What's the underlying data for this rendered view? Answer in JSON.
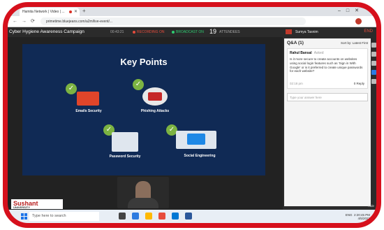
{
  "browser": {
    "tab_title": "Hamita Network | Video | ...",
    "url": "primetime.bluejeans.com/a2m/live-event/..."
  },
  "app": {
    "title": "Cyber Hygiene Awareness Campaign",
    "timer": "00:43:21",
    "recording_label": "RECORDING ON",
    "broadcast_label": "BROADCAST ON",
    "attendee_count": "19",
    "attendee_label": "ATTENDEES",
    "host_name": "Sumya Tasnim",
    "end_label": "END"
  },
  "slide": {
    "title": "Key Points",
    "points": [
      "Emails Security",
      "Phishing Attacks",
      "Password Security",
      "Social Engineering"
    ]
  },
  "logo": {
    "name": "Sushant",
    "sub": "UNIVERSITY"
  },
  "qa_panel": {
    "header": "Q&A (1)",
    "sort_label": "Sort by: Latest First",
    "question": {
      "author": "Rahul Bansal",
      "badge": "Asked",
      "text": "Is it more secure to create accounts on websites using social login features such as 'Sign in With Google' or is it preferred to create unique passwords for each website?",
      "time": "02:18 pm",
      "reply": "0 Reply"
    },
    "answer_placeholder": "Type your answer here"
  },
  "stage_bottom_label": "Hide",
  "taskbar": {
    "search_placeholder": "Type here to search",
    "time": "2:20:45 PM",
    "date": "4/5/2021",
    "lang": "ENG"
  },
  "colors": {
    "border": "#d6101c",
    "check": "#7cb342",
    "slide_bg": "#102a55"
  }
}
